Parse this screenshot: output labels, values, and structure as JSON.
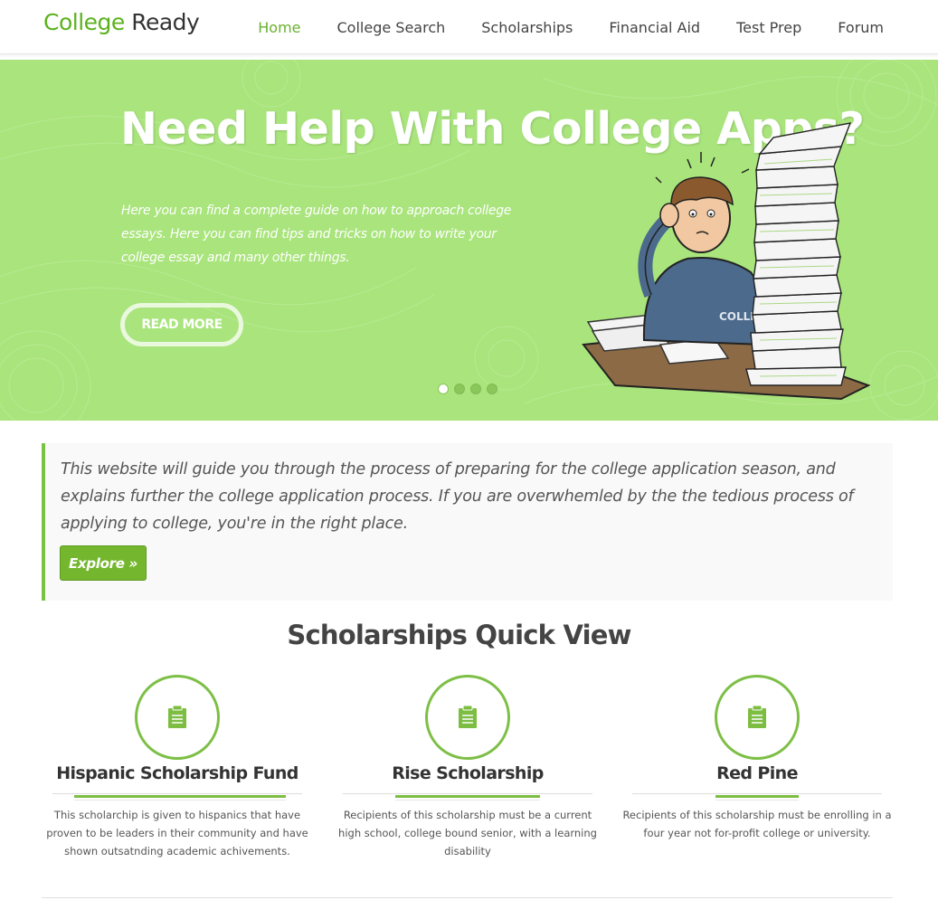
{
  "brand": {
    "part1": "College",
    "part2": "Ready"
  },
  "nav": {
    "items": [
      {
        "label": "Home",
        "active": true
      },
      {
        "label": "College Search",
        "active": false
      },
      {
        "label": "Scholarships",
        "active": false
      },
      {
        "label": "Financial Aid",
        "active": false
      },
      {
        "label": "Test Prep",
        "active": false
      },
      {
        "label": "Forum",
        "active": false
      }
    ]
  },
  "hero": {
    "title": "Need Help With College Apps?",
    "text": "Here you can find a complete guide on how to approach college essays. Here you can find tips and tricks on how to write your college essay and many other things.",
    "button": "Read More",
    "illustration_label": "COLLEGE",
    "slides": {
      "total": 4,
      "active": 1
    }
  },
  "intro": {
    "text": "This website will guide you through the process of preparing for the college application season, and explains further the college application process. If you are overwhemled by the the tedious process of applying to college, you're in the right place.",
    "button": "Explore »"
  },
  "scholarships": {
    "title": "Scholarships Quick View",
    "icon": "clipboard-icon",
    "items": [
      {
        "name": "Hispanic Scholarship Fund",
        "description": "This scholarchip is given to hispanics that have proven to be leaders in their community and have shown outsatnding academic achivements."
      },
      {
        "name": "Rise Scholarship",
        "description": "Recipients of this scholarship must be a current high school, college bound senior, with a learning disability"
      },
      {
        "name": "Red Pine",
        "description": "Recipients of this scholarship must be enrolling in a four year not for-profit college or university."
      }
    ]
  },
  "colors": {
    "accent": "#6ab131",
    "hero_bg": "#a9e47c",
    "button": "#74b72e"
  }
}
